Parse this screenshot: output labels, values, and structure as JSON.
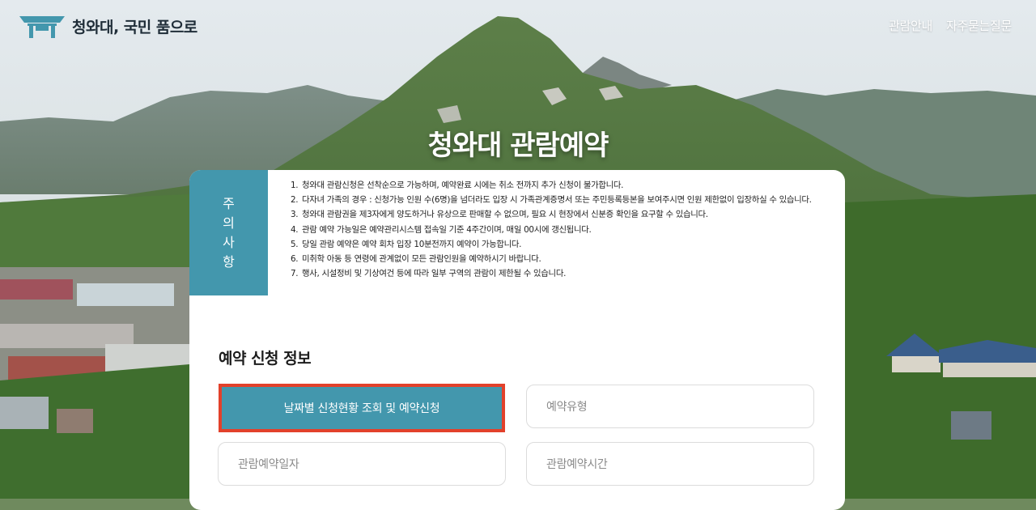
{
  "header": {
    "brand": "청와대, 국민 품으로",
    "nav": [
      "관람안내",
      "자주묻는질문"
    ]
  },
  "page_title": "청와대 관람예약",
  "notice": {
    "tag_chars": [
      "주",
      "의",
      "사",
      "항"
    ],
    "items": [
      {
        "num": "1.",
        "text": "청와대 관람신청은 선착순으로 가능하며, 예약완료 시에는 취소 전까지 추가 신청이 불가합니다."
      },
      {
        "num": "2.",
        "text": "다자녀 가족의 경우 : 신청가능 인원 수(6명)을 넘더라도 입장 시 가족관계증명서 또는 주민등록등본을 보여주시면 인원 제한없이 입장하실 수 있습니다."
      },
      {
        "num": "3.",
        "text": "청와대 관람권을 제3자에게 양도하거나 유상으로 판매할 수 없으며, 필요 시 현장에서 신분증 확인을 요구할 수 있습니다."
      },
      {
        "num": "4.",
        "text": "관람 예약 가능일은 예약관리시스템 접속일 기준 4주간이며, 매일 00시에 갱신됩니다."
      },
      {
        "num": "5.",
        "text": "당일 관람 예약은 예약 회차 입장 10분전까지 예약이 가능합니다."
      },
      {
        "num": "6.",
        "text": "미취학 아동 등 연령에 관계없이 모든 관람인원을 예약하시기 바랍니다."
      },
      {
        "num": "7.",
        "text": "행사, 시설정비 및 기상여건 등에 따라 일부 구역의 관람이 제한될 수 있습니다."
      }
    ]
  },
  "reservation": {
    "section_title": "예약 신청 정보",
    "primary_button": "날짜별 신청현황 조회 및 예약신청",
    "fields": {
      "type": "예약유형",
      "date": "관람예약일자",
      "time": "관람예약시간"
    }
  },
  "colors": {
    "accent": "#4397ad",
    "highlight": "#e2412b"
  },
  "icons": {
    "logo": "blue-house-roof-logo"
  }
}
